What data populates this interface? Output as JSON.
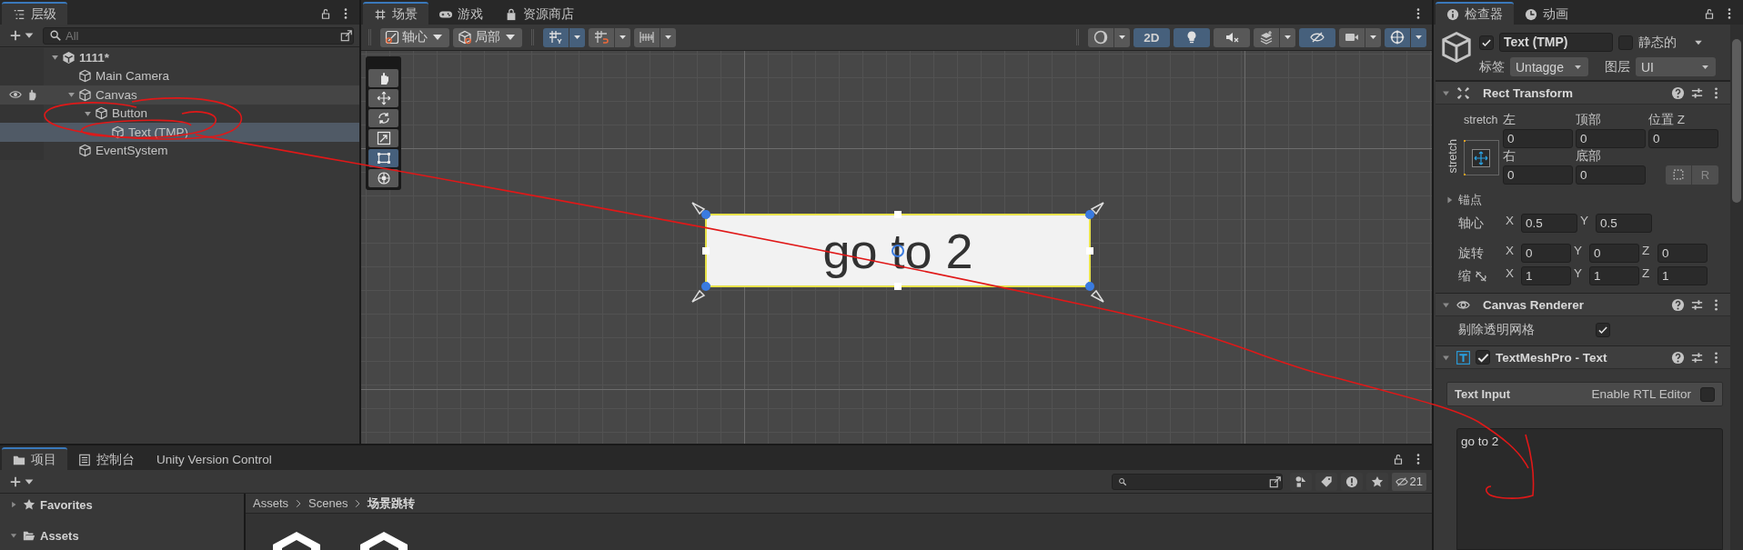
{
  "hierarchy": {
    "tab": "层级",
    "search": {
      "placeholder": "All"
    },
    "tree": [
      {
        "label": "1111*",
        "kind": "scene",
        "expanded": true,
        "selected": false,
        "hovered": false,
        "children": [
          {
            "label": "Main Camera",
            "kind": "object",
            "selected": false,
            "hovered": false
          },
          {
            "label": "Canvas",
            "kind": "object",
            "expanded": true,
            "selected": false,
            "hovered": true,
            "children": [
              {
                "label": "Button",
                "kind": "object",
                "expanded": true,
                "selected": false,
                "hovered": false,
                "children": [
                  {
                    "label": "Text (TMP)",
                    "kind": "object",
                    "selected": true,
                    "hovered": false
                  }
                ]
              }
            ]
          },
          {
            "label": "EventSystem",
            "kind": "object",
            "selected": false,
            "hovered": false
          }
        ]
      }
    ]
  },
  "scene_view": {
    "tabs": [
      {
        "label": "场景",
        "kind": "scene",
        "selected": true
      },
      {
        "label": "游戏",
        "kind": "game",
        "selected": false
      },
      {
        "label": "资源商店",
        "kind": "store",
        "selected": false
      }
    ],
    "toolbar": {
      "pivot_label": "轴心",
      "space_label": "局部",
      "left_toggles": [
        {
          "kind": "grid",
          "on": true
        },
        {
          "kind": "snap",
          "on": false
        },
        {
          "kind": "increment",
          "on": false
        }
      ],
      "right_toggles": [
        {
          "kind": "shading",
          "on": false
        },
        {
          "kind": "dimension",
          "label": "2D",
          "on": true
        },
        {
          "kind": "light",
          "on": true
        },
        {
          "kind": "audio",
          "on": false
        },
        {
          "kind": "effects",
          "on": false
        },
        {
          "kind": "visibility",
          "on": true
        },
        {
          "kind": "camera",
          "on": false
        },
        {
          "kind": "gizmos",
          "on": true
        }
      ]
    },
    "tools": [
      {
        "kind": "hand",
        "selected": false
      },
      {
        "kind": "move",
        "selected": false
      },
      {
        "kind": "rotate",
        "selected": false
      },
      {
        "kind": "scale",
        "selected": false
      },
      {
        "kind": "rect",
        "selected": true
      },
      {
        "kind": "transform",
        "selected": false
      }
    ],
    "canvas_button": {
      "text": "go to 2"
    }
  },
  "inspector": {
    "tabs": [
      {
        "label": "检查器",
        "kind": "info",
        "selected": true
      },
      {
        "label": "动画",
        "kind": "clock",
        "selected": false
      }
    ],
    "object": {
      "active": true,
      "name": "Text (TMP)",
      "static_label": "静态的",
      "static": false,
      "tag_label": "标签",
      "tag": "Untagge",
      "layer_label": "图层",
      "layer": "UI"
    },
    "rect_transform": {
      "title": "Rect Transform",
      "expanded": true,
      "preset_h": "stretch",
      "preset_v": "stretch",
      "offsets": [
        {
          "label": "左",
          "value": "0"
        },
        {
          "label": "顶部",
          "value": "0"
        },
        {
          "label": "位置 Z",
          "value": "0"
        },
        {
          "label": "右",
          "value": "0"
        },
        {
          "label": "底部",
          "value": "0"
        }
      ],
      "raw_button": "R",
      "anchors": {
        "label": "锚点",
        "expanded": false
      },
      "vectors": [
        {
          "label": "轴心",
          "fields": [
            {
              "axis": "X",
              "value": "0.5"
            },
            {
              "axis": "Y",
              "value": "0.5"
            }
          ]
        },
        {
          "label": "旋转",
          "fields": [
            {
              "axis": "X",
              "value": "0"
            },
            {
              "axis": "Y",
              "value": "0"
            },
            {
              "axis": "Z",
              "value": "0"
            }
          ]
        },
        {
          "label": "缩",
          "linked": false,
          "fields": [
            {
              "axis": "X",
              "value": "1"
            },
            {
              "axis": "Y",
              "value": "1"
            },
            {
              "axis": "Z",
              "value": "1"
            }
          ]
        }
      ]
    },
    "canvas_renderer": {
      "title": "Canvas Renderer",
      "expanded": true,
      "cull_label": "剔除透明网格",
      "cull": true
    },
    "text_mesh_pro": {
      "title": "TextMeshPro - Text",
      "expanded": true,
      "enabled": true,
      "input_label": "Text Input",
      "rtl_label": "Enable RTL Editor",
      "rtl": false,
      "text": "go to 2"
    }
  },
  "project": {
    "tabs": [
      {
        "label": "项目",
        "kind": "folder",
        "selected": true
      },
      {
        "label": "控制台",
        "kind": "console",
        "selected": false
      },
      {
        "label": "Unity Version Control",
        "kind": "none",
        "selected": false
      }
    ],
    "hidden_count": "21",
    "tree": [
      {
        "label": "Favorites",
        "kind": "favorites",
        "expanded": false
      },
      {
        "label": "Assets",
        "kind": "folder",
        "expanded": true
      }
    ],
    "breadcrumb": [
      "Assets",
      "Scenes",
      "场景跳转"
    ]
  }
}
